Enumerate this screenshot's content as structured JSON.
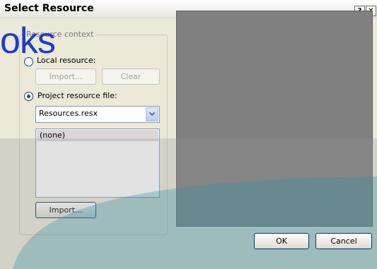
{
  "window": {
    "title": "Select Resource",
    "help_label": "?",
    "close_label": "✕"
  },
  "overlay_text": "oks",
  "group": {
    "legend": "Resource context"
  },
  "local_resource": {
    "label": "Local resource:",
    "import_label": "Import...",
    "clear_label": "Clear"
  },
  "project_resource": {
    "label": "Project resource file:",
    "file_value": "Resources.resx",
    "list_items": [
      "(none)"
    ],
    "import_label": "Import..."
  },
  "buttons": {
    "ok_label": "OK",
    "cancel_label": "Cancel"
  }
}
